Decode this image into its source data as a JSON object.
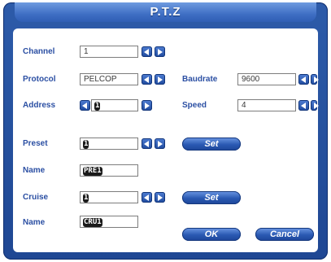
{
  "title": "P.T.Z",
  "rows": {
    "channel": {
      "label": "Channel",
      "value": "1"
    },
    "protocol": {
      "label": "Protocol",
      "value": "PELCOP"
    },
    "baudrate": {
      "label": "Baudrate",
      "value": "9600"
    },
    "address": {
      "label": "Address",
      "value": "1"
    },
    "speed": {
      "label": "Speed",
      "value": "4"
    },
    "preset": {
      "label": "Preset",
      "value": "1",
      "set_label": "Set"
    },
    "preset_name": {
      "label": "Name",
      "value": "PRE1"
    },
    "cruise": {
      "label": "Cruise",
      "value": "1",
      "set_label": "Set"
    },
    "cruise_name": {
      "label": "Name",
      "value": "CRU1"
    }
  },
  "buttons": {
    "ok": "OK",
    "cancel": "Cancel"
  },
  "colors": {
    "frame": "#2d5ba9",
    "label": "#2b4fa3",
    "button": "#2a59b2"
  }
}
